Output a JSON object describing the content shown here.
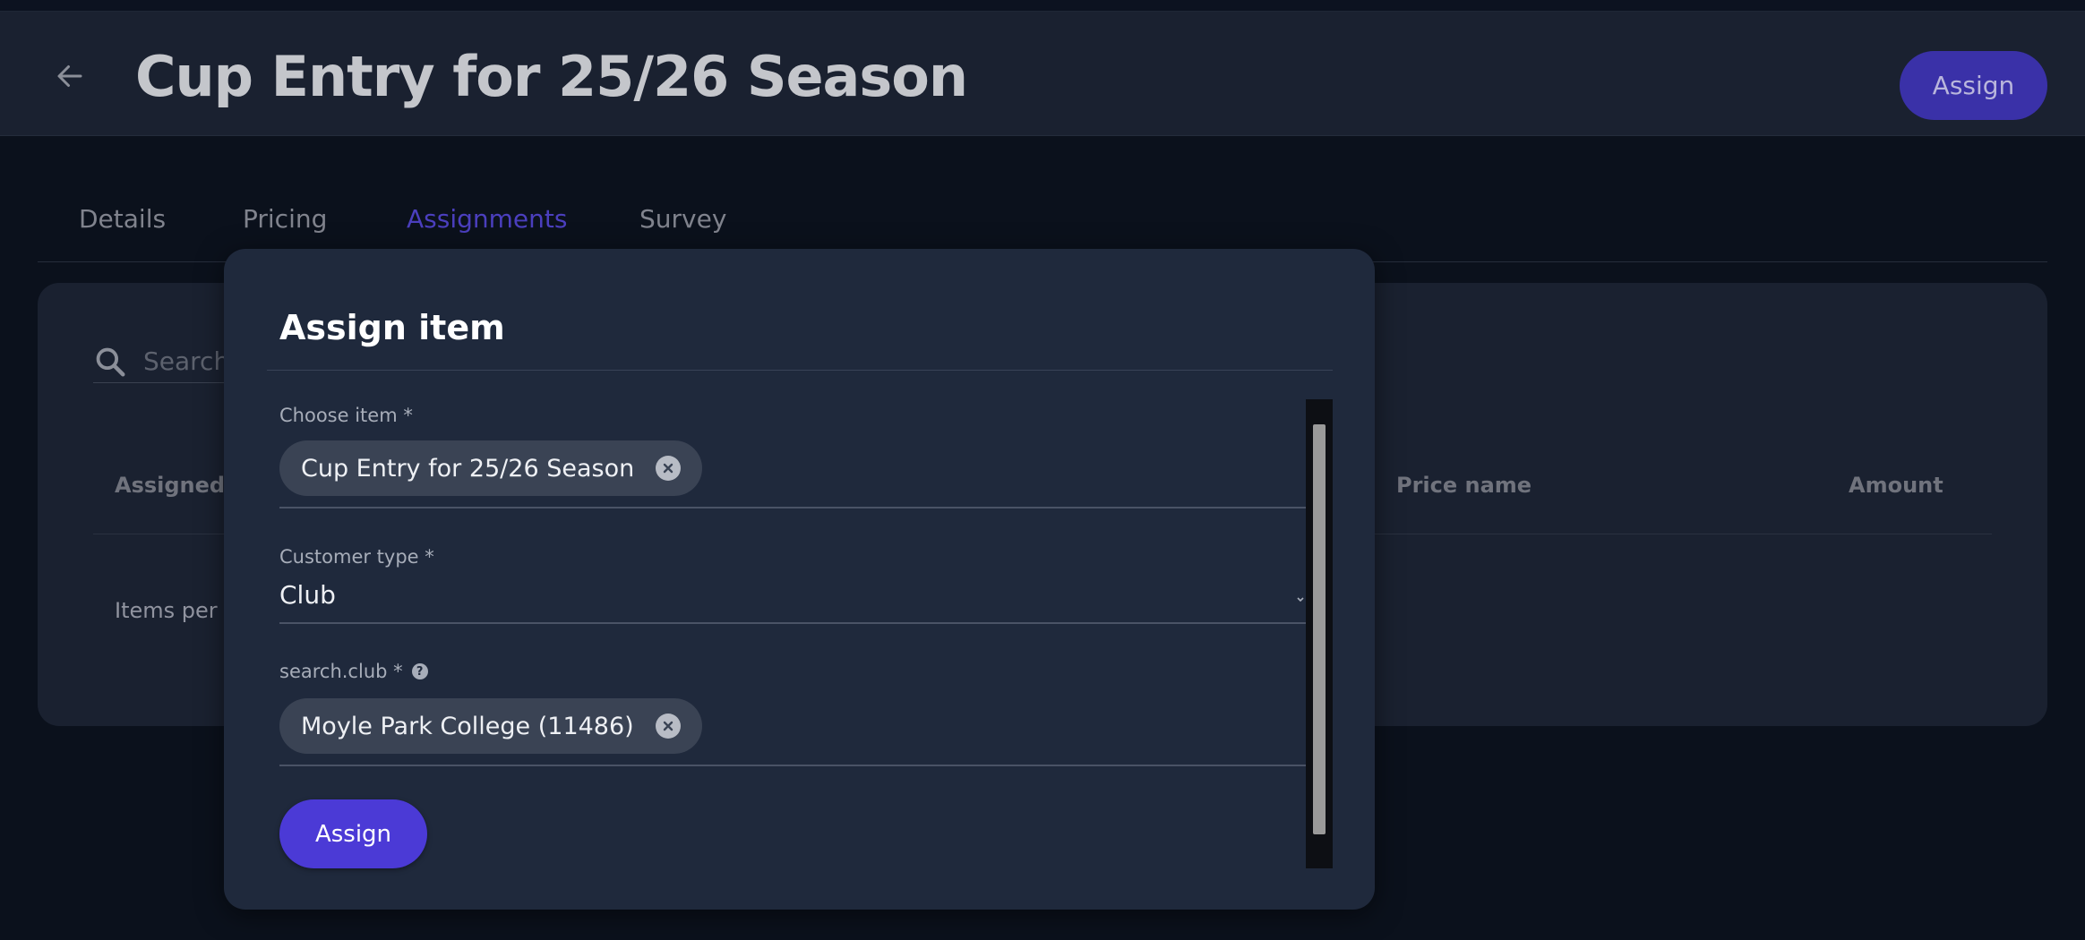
{
  "header": {
    "title": "Cup Entry for 25/26 Season",
    "assign_label": "Assign"
  },
  "tabs": [
    {
      "label": "Details",
      "active": false
    },
    {
      "label": "Pricing",
      "active": false
    },
    {
      "label": "Assignments",
      "active": true
    },
    {
      "label": "Survey",
      "active": false
    }
  ],
  "table": {
    "search_placeholder": "Search",
    "columns": [
      "Assigned to",
      "Price name",
      "Amount"
    ],
    "items_per_page_label": "Items per page"
  },
  "dialog": {
    "title": "Assign item",
    "fields": {
      "choose_item": {
        "label": "Choose item *",
        "value": "Cup Entry for 25/26 Season"
      },
      "customer_type": {
        "label": "Customer type *",
        "value": "Club"
      },
      "search_club": {
        "label": "search.club *",
        "help": "?",
        "value": "Moyle Park College (11486)"
      }
    },
    "assign_label": "Assign"
  },
  "icons": {
    "back": "arrow-left-icon",
    "search": "search-icon",
    "chip_remove": "close-circle-icon",
    "help": "help-circle-icon",
    "select": "chevron-down-icon"
  },
  "colors": {
    "accent": "#4b3ad6",
    "active_tab": "#4b3fbe",
    "background": "#0b111c",
    "surface": "#1a2130",
    "dialog": "#1f293c"
  }
}
